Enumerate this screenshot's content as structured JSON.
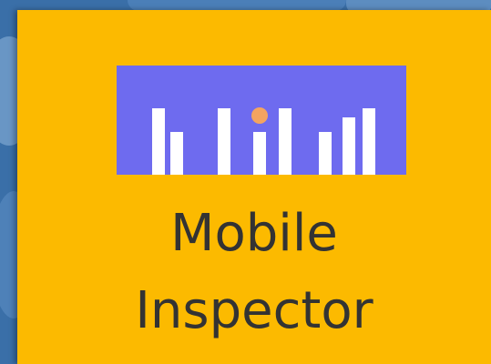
{
  "tile": {
    "title_line1": "Mobile",
    "title_line2": "Inspector",
    "background_color": "#fcba00",
    "text_color": "#333333"
  },
  "logo": {
    "icon": "bar-chart-logo-icon",
    "panel_color": "#6e6bef",
    "bar_color": "#ffffff",
    "dot_color": "#f4a460"
  },
  "background": {
    "color": "#3a6fa8"
  }
}
